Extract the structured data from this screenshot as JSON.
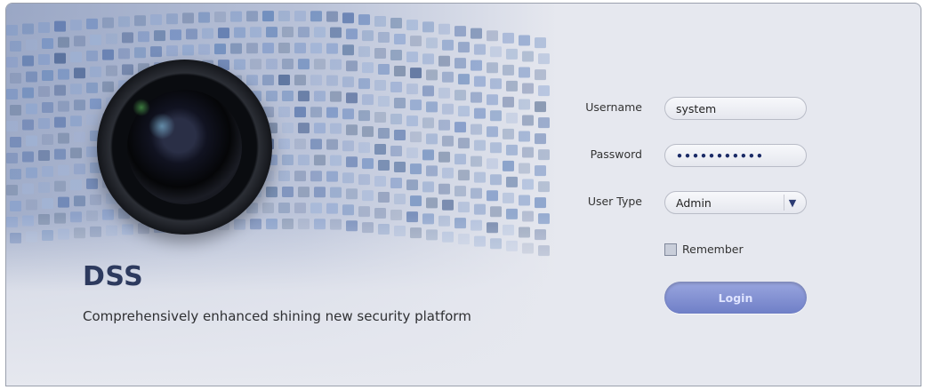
{
  "brand": {
    "title": "DSS",
    "tagline": "Comprehensively enhanced shining new security platform"
  },
  "login_form": {
    "username_label": "Username",
    "username_value": "system",
    "password_label": "Password",
    "password_value": "•••••••••••",
    "user_type_label": "User Type",
    "user_type_value": "Admin",
    "remember_label": "Remember",
    "remember_checked": false,
    "login_button": "Login"
  },
  "colors": {
    "brand_title": "#2d3a5e",
    "login_button": "#7f8fd0",
    "background": "#e6e8ef"
  },
  "icons": {
    "user_type_caret": "chevron-down-icon"
  }
}
